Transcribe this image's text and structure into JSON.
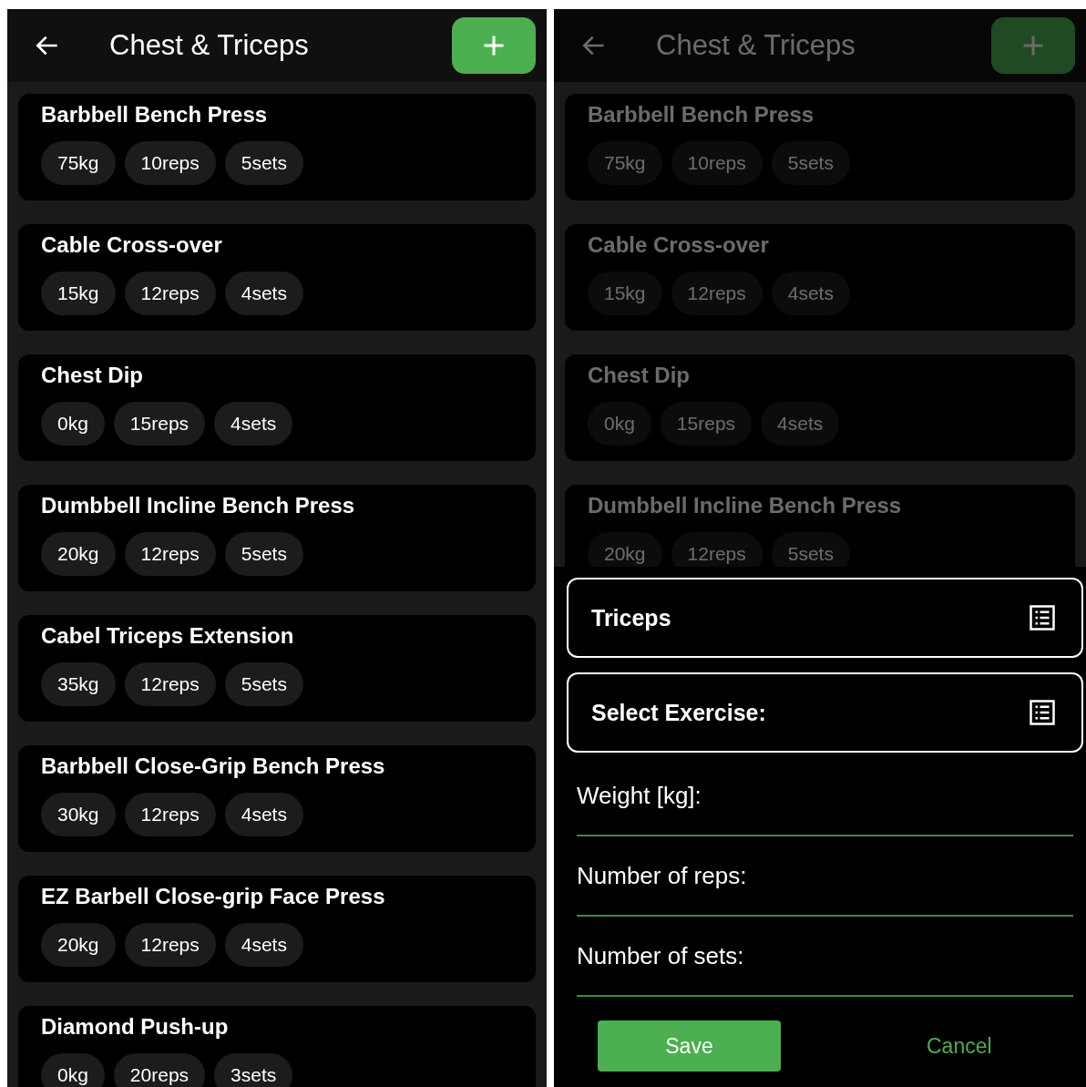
{
  "screens": [
    {
      "title": "Chest & Triceps",
      "dimmed": false,
      "exercises": [
        {
          "name": "Barbbell Bench Press",
          "chips": [
            "75kg",
            "10reps",
            "5sets"
          ]
        },
        {
          "name": "Cable Cross-over",
          "chips": [
            "15kg",
            "12reps",
            "4sets"
          ]
        },
        {
          "name": "Chest Dip",
          "chips": [
            "0kg",
            "15reps",
            "4sets"
          ]
        },
        {
          "name": "Dumbbell Incline Bench Press",
          "chips": [
            "20kg",
            "12reps",
            "5sets"
          ]
        },
        {
          "name": "Cabel Triceps Extension",
          "chips": [
            "35kg",
            "12reps",
            "5sets"
          ]
        },
        {
          "name": "Barbbell Close-Grip Bench Press",
          "chips": [
            "30kg",
            "12reps",
            "4sets"
          ]
        },
        {
          "name": "EZ Barbell Close-grip Face Press",
          "chips": [
            "20kg",
            "12reps",
            "4sets"
          ]
        },
        {
          "name": "Diamond Push-up",
          "chips": [
            "0kg",
            "20reps",
            "3sets"
          ]
        }
      ]
    },
    {
      "title": "Chest & Triceps",
      "dimmed": true,
      "exercises": [
        {
          "name": "Barbbell Bench Press",
          "chips": [
            "75kg",
            "10reps",
            "5sets"
          ]
        },
        {
          "name": "Cable Cross-over",
          "chips": [
            "15kg",
            "12reps",
            "4sets"
          ]
        },
        {
          "name": "Chest Dip",
          "chips": [
            "0kg",
            "15reps",
            "4sets"
          ]
        },
        {
          "name": "Dumbbell Incline Bench Press",
          "chips": [
            "20kg",
            "12reps",
            "5sets"
          ]
        }
      ],
      "sheet": {
        "dropdowns": [
          {
            "value": "Triceps"
          },
          {
            "placeholder": "Select Exercise:"
          }
        ],
        "fields": [
          {
            "placeholder": "Weight [kg]:"
          },
          {
            "placeholder": "Number of reps:"
          },
          {
            "placeholder": "Number of sets:"
          }
        ],
        "buttons": [
          {
            "label": "Save",
            "kind": "primary"
          },
          {
            "label": "Cancel",
            "kind": "text"
          }
        ]
      }
    }
  ]
}
